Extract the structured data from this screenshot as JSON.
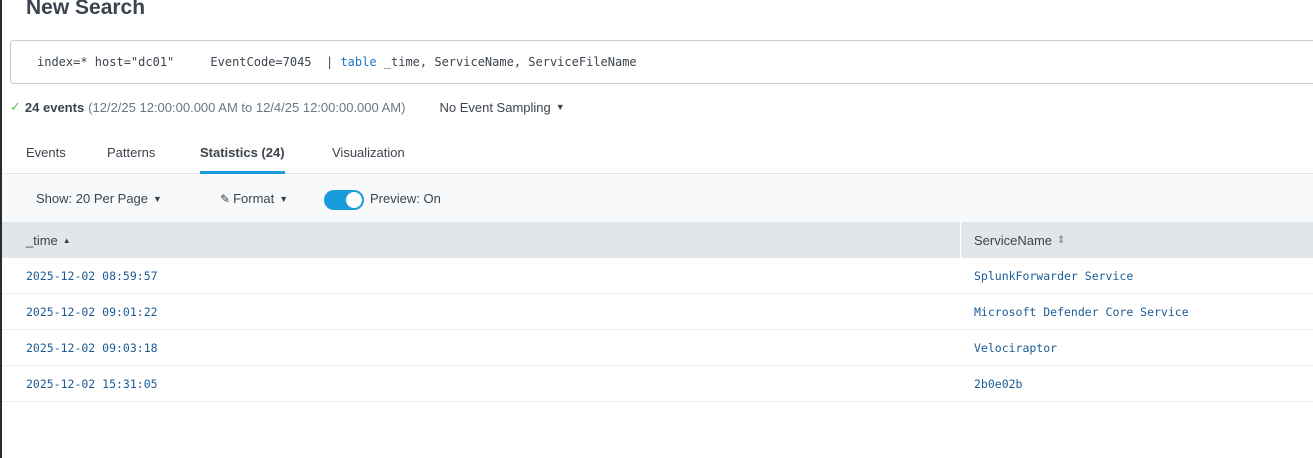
{
  "page": {
    "title": "New Search"
  },
  "search": {
    "query_prefix": "index=* host=\"dc01\"     EventCode=7045  | ",
    "query_command": "table",
    "query_suffix": " _time, ServiceName, ServiceFileName"
  },
  "status": {
    "count_text": "24 events",
    "range_text": "(12/2/25 12:00:00.000 AM to 12/4/25 12:00:00.000 AM)",
    "sampling_label": "No Event Sampling"
  },
  "tabs": [
    {
      "label": "Events"
    },
    {
      "label": "Patterns"
    },
    {
      "label": "Statistics (24)",
      "active": true
    },
    {
      "label": "Visualization"
    }
  ],
  "toolbar": {
    "show_label": "Show: 20 Per Page",
    "format_label": "Format",
    "preview_label": "Preview: On",
    "preview_on": true
  },
  "table": {
    "columns": [
      "_time",
      "ServiceName"
    ],
    "rows": [
      {
        "time": "2025-12-02 08:59:57",
        "service": "SplunkForwarder Service"
      },
      {
        "time": "2025-12-02 09:01:22",
        "service": "Microsoft Defender Core Service"
      },
      {
        "time": "2025-12-02 09:03:18",
        "service": "Velociraptor"
      },
      {
        "time": "2025-12-02 15:31:05",
        "service": "2b0e02b"
      }
    ]
  },
  "colors": {
    "accent": "#1a9cdc",
    "link": "#1a5c96",
    "header_bg": "#e1e6eb",
    "success": "#5cc05c"
  }
}
